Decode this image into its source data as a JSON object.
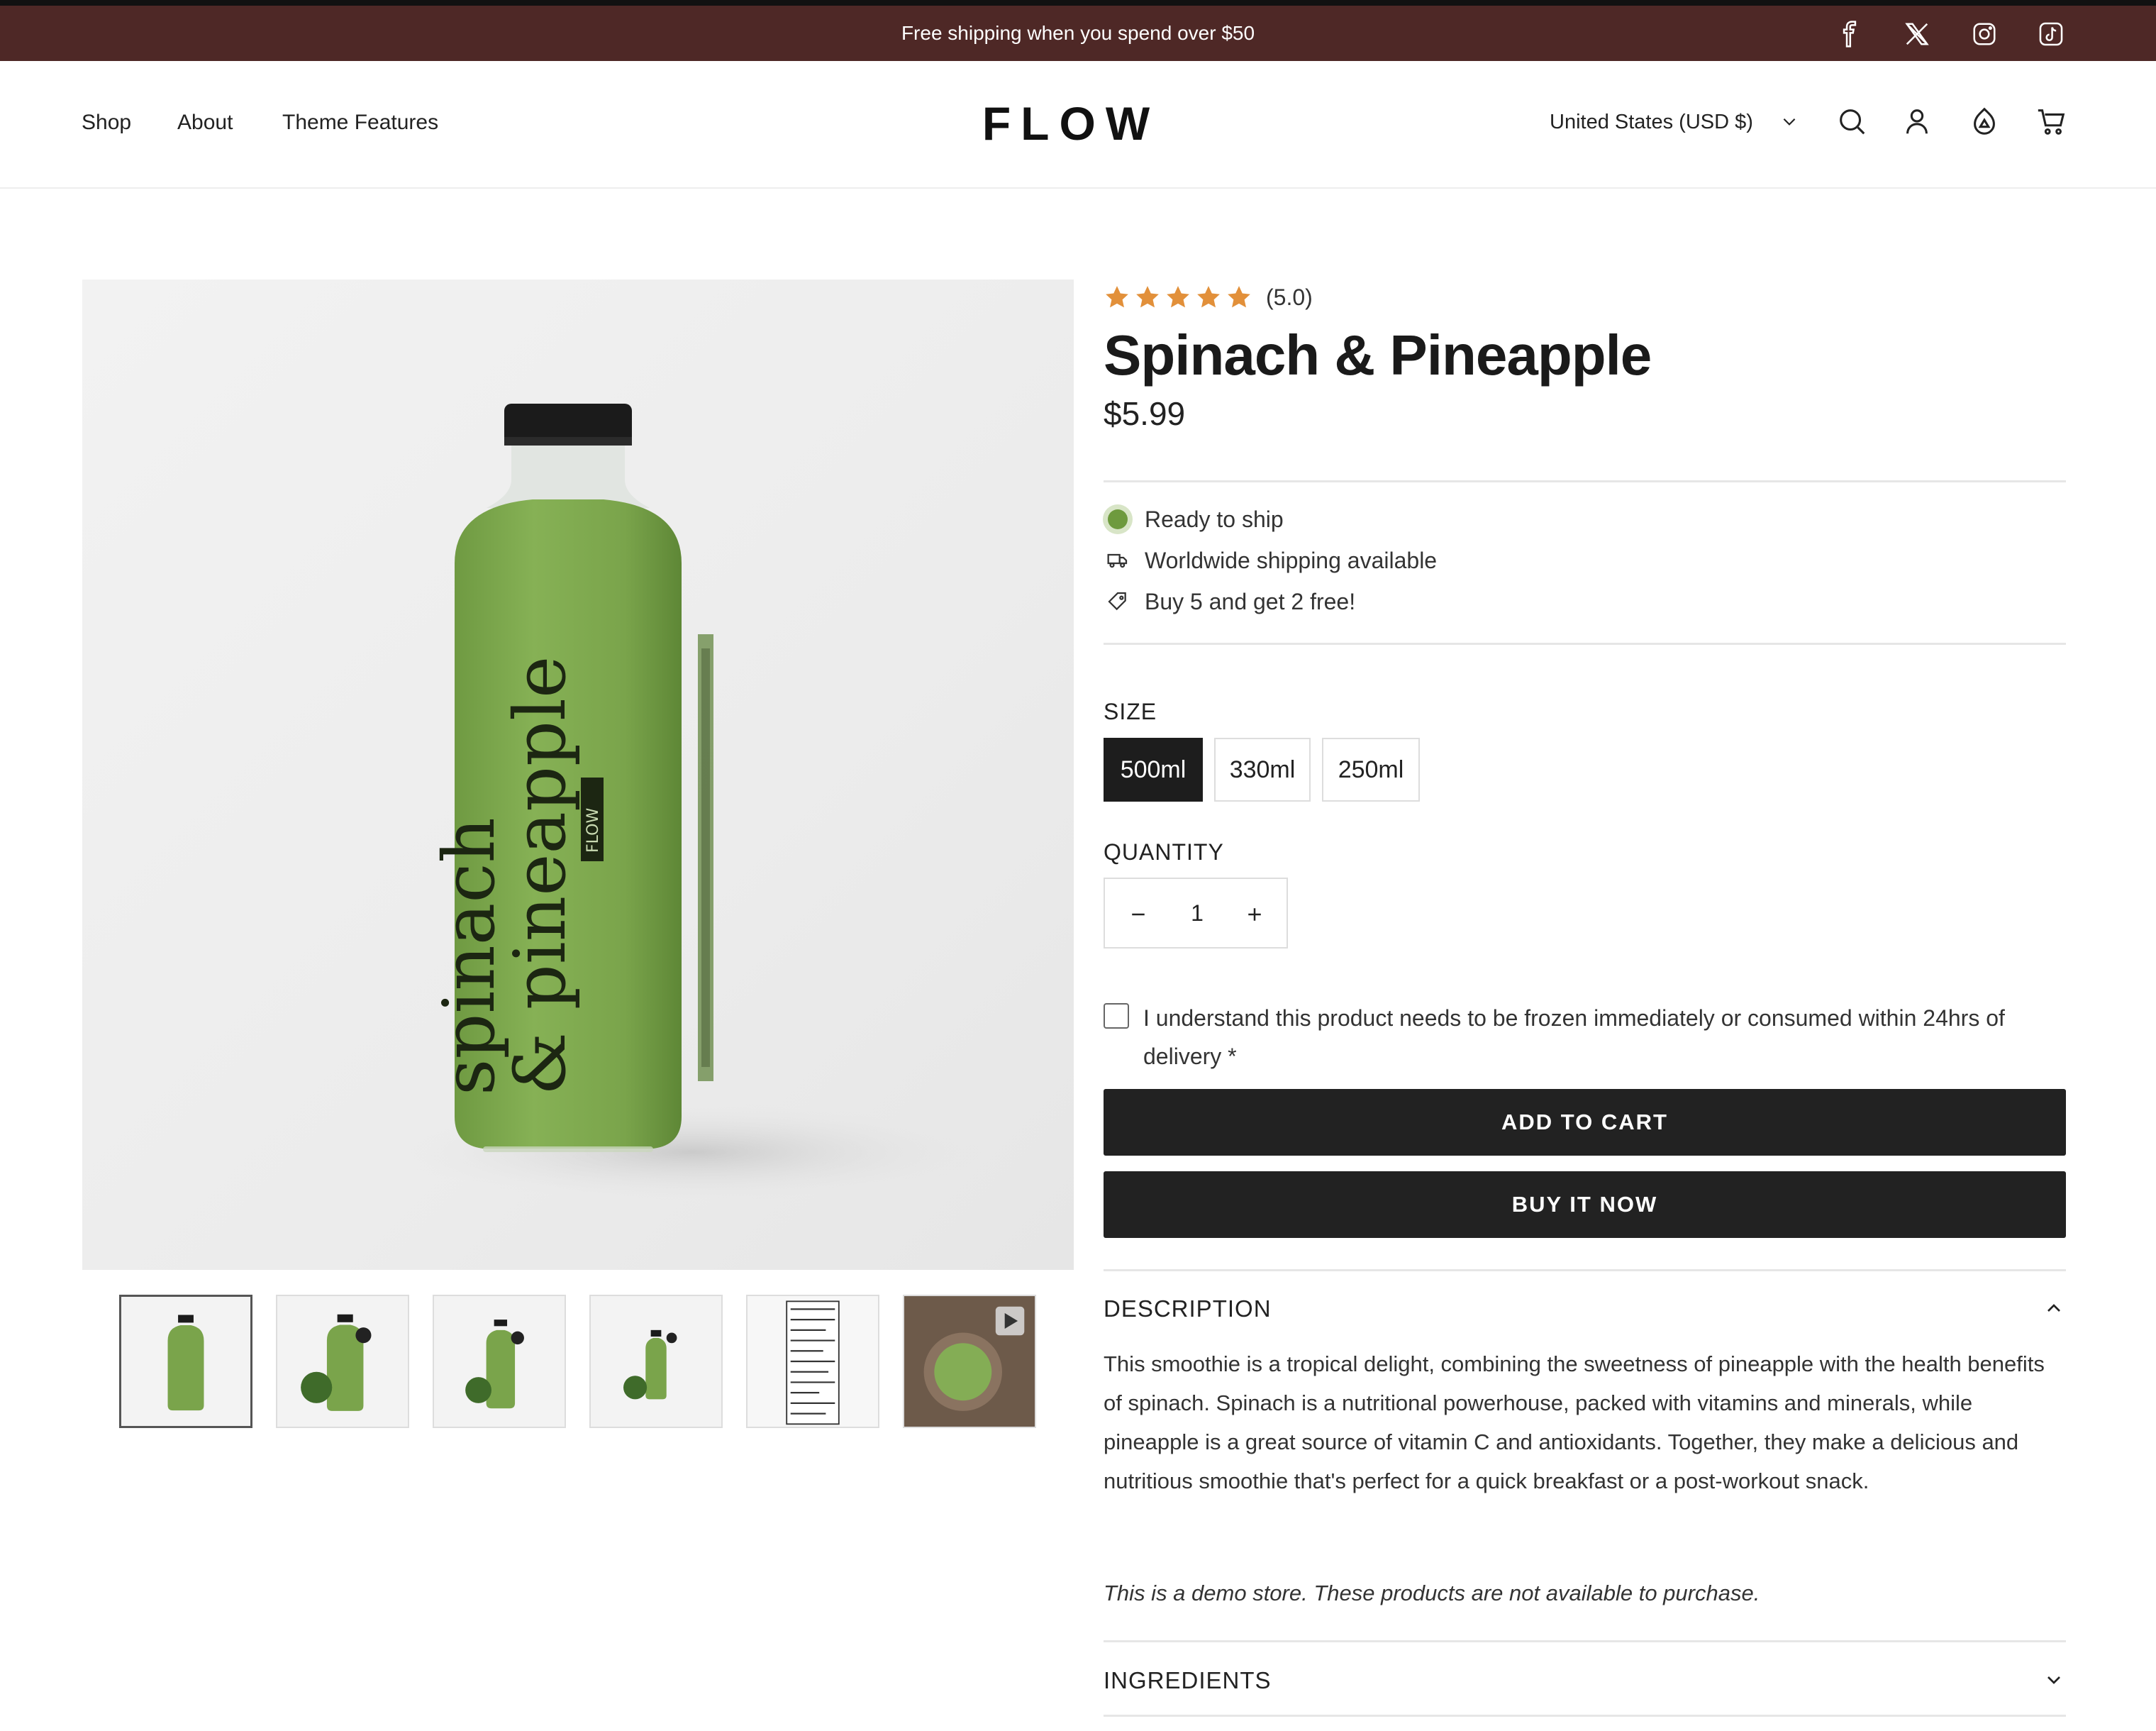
{
  "announcement": {
    "text": "Free shipping when you spend over $50"
  },
  "social": [
    "facebook-icon",
    "x-icon",
    "instagram-icon",
    "tiktok-icon"
  ],
  "nav": {
    "items": [
      "Shop",
      "About",
      "Theme Features"
    ]
  },
  "logo": "FLOW",
  "header": {
    "country": "United States (USD $)"
  },
  "product": {
    "rating": {
      "stars": 5,
      "text": "(5.0)"
    },
    "title": "Spinach & Pineapple",
    "price": "$5.99",
    "features": [
      "Ready to ship",
      "Worldwide shipping available",
      "Buy 5 and get 2 free!"
    ],
    "size_label": "SIZE",
    "sizes": [
      "500ml",
      "330ml",
      "250ml"
    ],
    "selected_size": "500ml",
    "quantity_label": "QUANTITY",
    "quantity": "1",
    "consent": "I understand this product needs to be frozen immediately or consumed within 24hrs of delivery *",
    "add_to_cart": "ADD TO CART",
    "buy_now": "BUY IT NOW",
    "bottle_label": {
      "line1": "spinach",
      "line2": "& pineapple",
      "brand": "FLOW"
    }
  },
  "accordion": {
    "description_title": "DESCRIPTION",
    "description": "This smoothie is a tropical delight, combining the sweetness of pineapple with the health benefits of spinach. Spinach is a nutritional powerhouse, packed with vitamins and minerals, while pineapple is a great source of vitamin C and antioxidants. Together, they make a delicious and nutritious smoothie that's perfect for a quick breakfast or a post-workout snack.",
    "note": "This is a demo store. These products are not available to purchase.",
    "ingredients_title": "INGREDIENTS"
  },
  "colors": {
    "announcement_bg": "#4e2826",
    "button_bg": "#222222",
    "star": "#e2903a",
    "bottle": "#7aa44b",
    "status_dot": "#6e9a3e"
  }
}
